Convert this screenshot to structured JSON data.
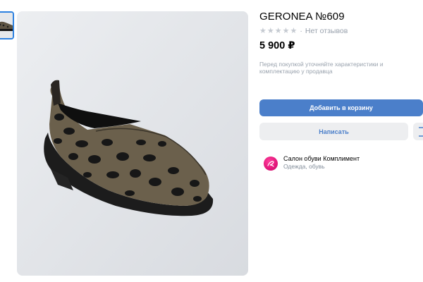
{
  "product": {
    "title": "GERONEA №609",
    "rating": {
      "stars_filled": 0,
      "stars_total": 5,
      "separator": "·",
      "reviews_text": "Нет отзывов"
    },
    "price": "5 900 ₽",
    "note": "Перед покупкой уточняйте характеристики и комплектацию у продавца"
  },
  "actions": {
    "add_to_cart": "Добавить в корзину",
    "message": "Написать"
  },
  "seller": {
    "name": "Салон обуви Комплимент",
    "category": "Одежда, обувь"
  },
  "colors": {
    "accent": "#4b7fca",
    "secondary_bg": "#edeef0",
    "muted_text": "#99a2ad",
    "avatar": "#e2167a"
  },
  "icons": {
    "star": "★",
    "more": "more-icon"
  }
}
